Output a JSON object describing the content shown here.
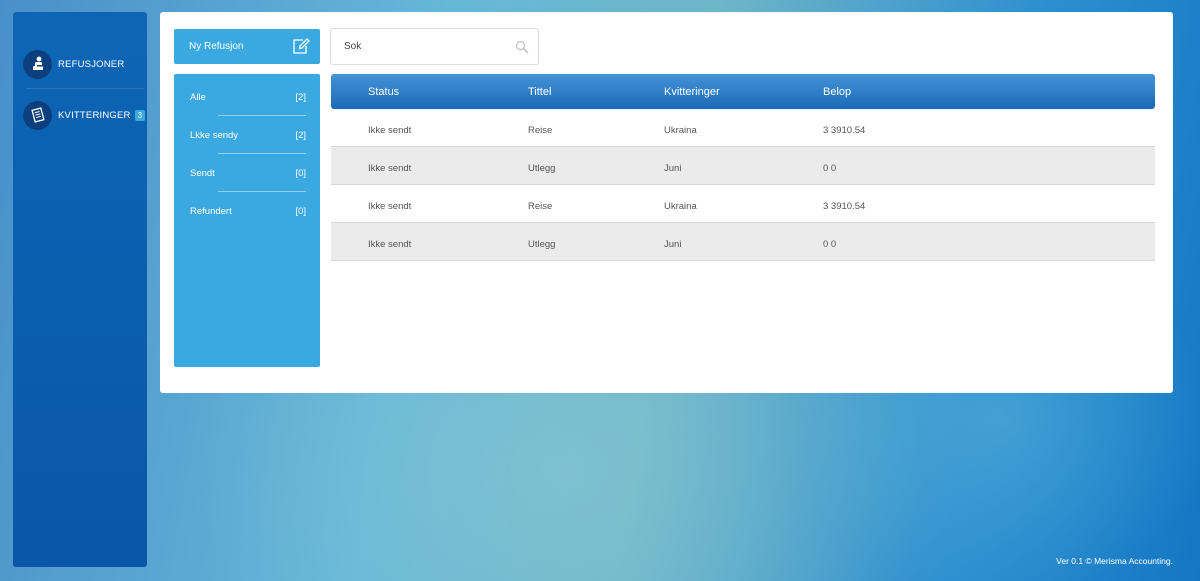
{
  "sidebar": {
    "items": [
      {
        "label": "REFUSJONER",
        "icon": "user-refund-icon"
      },
      {
        "label": "KVITTERINGER",
        "icon": "receipt-icon",
        "badge": "3"
      }
    ]
  },
  "toolbar": {
    "new_label": "Ny Refusjon",
    "new_icon": "edit-icon",
    "search_placeholder": "Sok",
    "search_icon": "search-icon"
  },
  "filters": [
    {
      "label": "Alle",
      "count": "[2]"
    },
    {
      "label": "Lkke sendy",
      "count": "[2]"
    },
    {
      "label": "Sendt",
      "count": "[0]"
    },
    {
      "label": "Refundert",
      "count": "[0]"
    }
  ],
  "table": {
    "columns": [
      "Status",
      "Tittel",
      "Kvitteringer",
      "Belop"
    ],
    "rows": [
      [
        "Ikke sendt",
        "Reise",
        "Ukraina",
        "3  3910.54"
      ],
      [
        "Ikke sendt",
        "Utlegg",
        "Juni",
        "0  0"
      ],
      [
        "Ikke sendt",
        "Reise",
        "Ukraina",
        "3  3910.54"
      ],
      [
        "Ikke sendt",
        "Utlegg",
        "Juni",
        "0  0"
      ]
    ]
  },
  "footer": {
    "text": "Ver 0.1 © Merisma Accounting."
  },
  "colors": {
    "accent": "#3aa9e1",
    "sidebar": "#0d66b5",
    "header": "#1b6ab9"
  }
}
